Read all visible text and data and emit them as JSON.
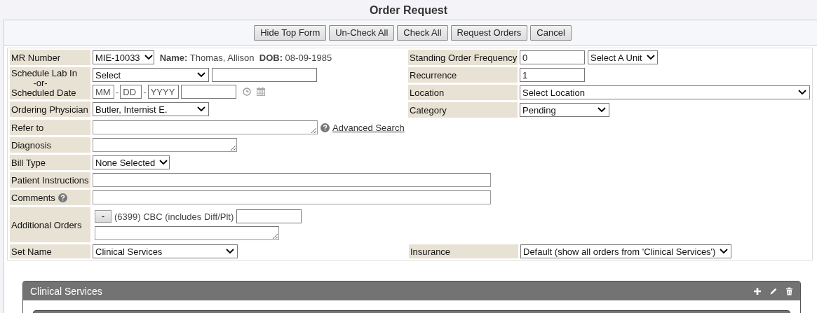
{
  "title": "Order Request",
  "toolbar": [
    {
      "label": "Hide Top Form"
    },
    {
      "label": "Un-Check All"
    },
    {
      "label": "Check All"
    },
    {
      "label": "Request Orders"
    },
    {
      "label": "Cancel"
    }
  ],
  "mr_number": {
    "label": "MR Number",
    "value": "MIE-10033",
    "name_label": "Name:",
    "name": "Thomas, Allison",
    "dob_label": "DOB:",
    "dob": "08-09-1985"
  },
  "schedule": {
    "label_lines": [
      "Schedule Lab In",
      "-or-",
      "Scheduled Date"
    ],
    "lab_select": "Select",
    "date_separator": "-",
    "month_placeholder": "MM",
    "day_placeholder": "DD",
    "year_placeholder": "YYYY"
  },
  "ordering_physician": {
    "label": "Ordering Physician",
    "value": "Butler, Internist E."
  },
  "standing_order_frequency": {
    "label": "Standing Order Frequency",
    "value": "0",
    "unit": "Select A Unit"
  },
  "recurrence": {
    "label": "Recurrence",
    "value": "1"
  },
  "location": {
    "label": "Location",
    "value": "Select Location"
  },
  "category": {
    "label": "Category",
    "value": "Pending"
  },
  "refer_to": {
    "label": "Refer to",
    "link": "Advanced Search"
  },
  "diagnosis": {
    "label": "Diagnosis"
  },
  "bill_type": {
    "label": "Bill Type",
    "value": "None Selected"
  },
  "patient_instructions": {
    "label": "Patient Instructions"
  },
  "comments": {
    "label": "Comments"
  },
  "additional_orders": {
    "label": "Additional Orders",
    "remove_button": "-",
    "order": "(6399) CBC (includes Diff/Plt)"
  },
  "set_name": {
    "label": "Set Name",
    "value": "Clinical Services"
  },
  "insurance": {
    "label": "Insurance",
    "value": "Default (show all orders from 'Clinical Services')"
  },
  "panel": {
    "title": "Clinical Services"
  }
}
